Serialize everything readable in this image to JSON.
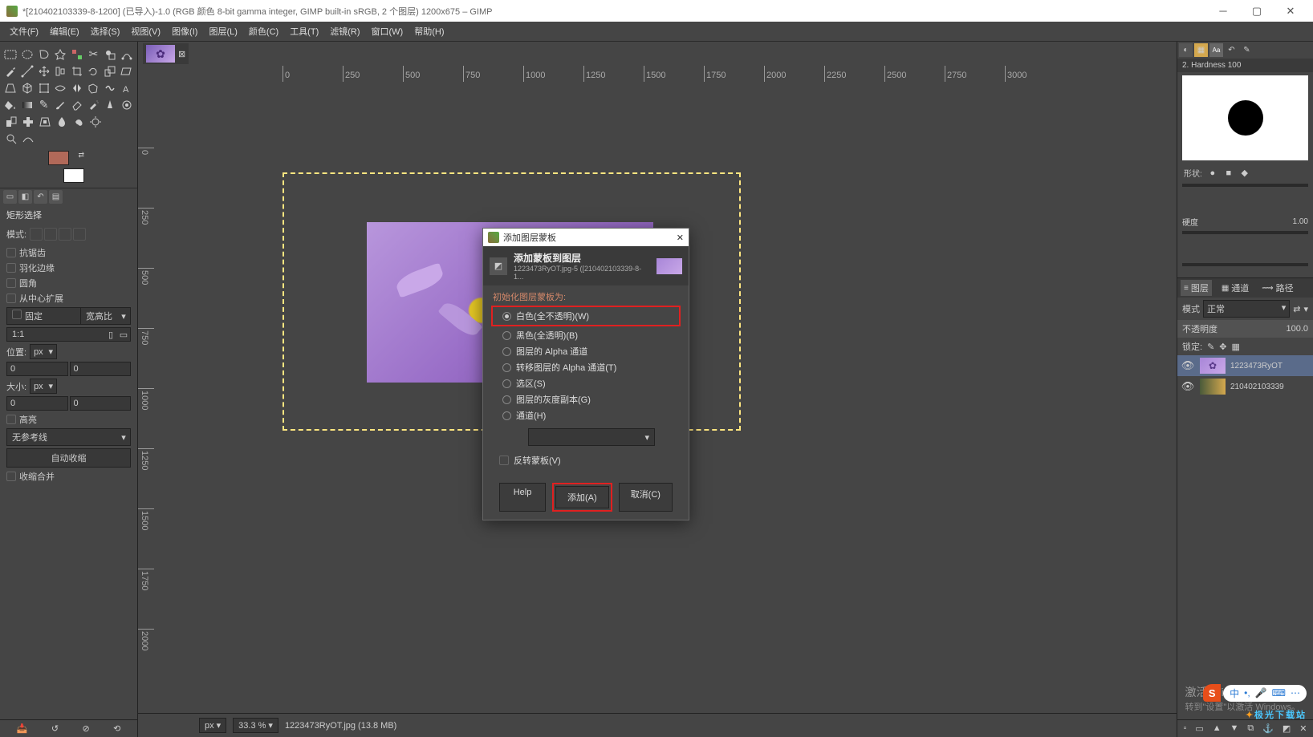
{
  "titlebar": {
    "text": "*[210402103339-8-1200] (已导入)-1.0 (RGB 颜色 8-bit gamma integer, GIMP built-in sRGB, 2 个图层) 1200x675 – GIMP"
  },
  "menubar": {
    "items": [
      "文件(F)",
      "编辑(E)",
      "选择(S)",
      "视图(V)",
      "图像(I)",
      "图层(L)",
      "颜色(C)",
      "工具(T)",
      "滤镜(R)",
      "窗口(W)",
      "帮助(H)"
    ]
  },
  "tool_options": {
    "title": "矩形选择",
    "mode_label": "模式:",
    "antialias": "抗锯齿",
    "feather": "羽化边缘",
    "rounded": "圆角",
    "expand_center": "从中心扩展",
    "fixed": "固定",
    "aspect": "宽高比",
    "ratio": "1:1",
    "pos_label": "位置:",
    "pos_x": "0",
    "pos_y": "0",
    "size_label": "大小:",
    "size_w": "0",
    "size_h": "0",
    "unit": "px",
    "highlight": "高亮",
    "guides": "无参考线",
    "autoshrink": "自动收缩",
    "shrink_merged": "收缩合并"
  },
  "statusbar": {
    "unit": "px",
    "zoom": "33.3 %",
    "file": "1223473RyOT.jpg (13.8 MB)"
  },
  "right": {
    "brush_title": "2. Hardness 100",
    "shape_label": "形状:",
    "hardness_label": "硬度",
    "hardness_val": "1.00",
    "layers_tabs": {
      "layers": "图层",
      "channels": "通道",
      "paths": "路径"
    },
    "mode_label": "模式",
    "mode_value": "正常",
    "opacity_label": "不透明度",
    "opacity_value": "100.0",
    "lock_label": "锁定:",
    "layers": [
      {
        "name": "1223473RyOT"
      },
      {
        "name": "210402103339"
      }
    ]
  },
  "dialog": {
    "window_title": "添加图层蒙板",
    "title": "添加蒙板到图层",
    "subtitle": "1223473RyOT.jpg-5 ([210402103339-8-1...",
    "section": "初始化图层蒙板为:",
    "options": {
      "white": "白色(全不透明)(W)",
      "black": "黑色(全透明)(B)",
      "alpha": "图层的 Alpha 通道",
      "transfer_alpha": "转移图层的 Alpha 通道(T)",
      "selection": "选区(S)",
      "gray": "图层的灰度副本(G)",
      "channel": "通道(H)"
    },
    "invert": "反转蒙板(V)",
    "help": "Help",
    "add": "添加(A)",
    "cancel": "取消(C)"
  },
  "ruler_h": [
    "0",
    "250",
    "500",
    "750",
    "1000",
    "1250",
    "1500",
    "1750",
    "2000",
    "2250",
    "2500",
    "2750",
    "3000"
  ],
  "ruler_v": [
    "0",
    "250",
    "500",
    "750",
    "1000",
    "1250",
    "1500",
    "1750",
    "2000"
  ],
  "watermark": {
    "line1": "激活 Windows",
    "line2": "转到\"设置\"以激活 Windows。"
  },
  "site_badge": "极光下载站"
}
